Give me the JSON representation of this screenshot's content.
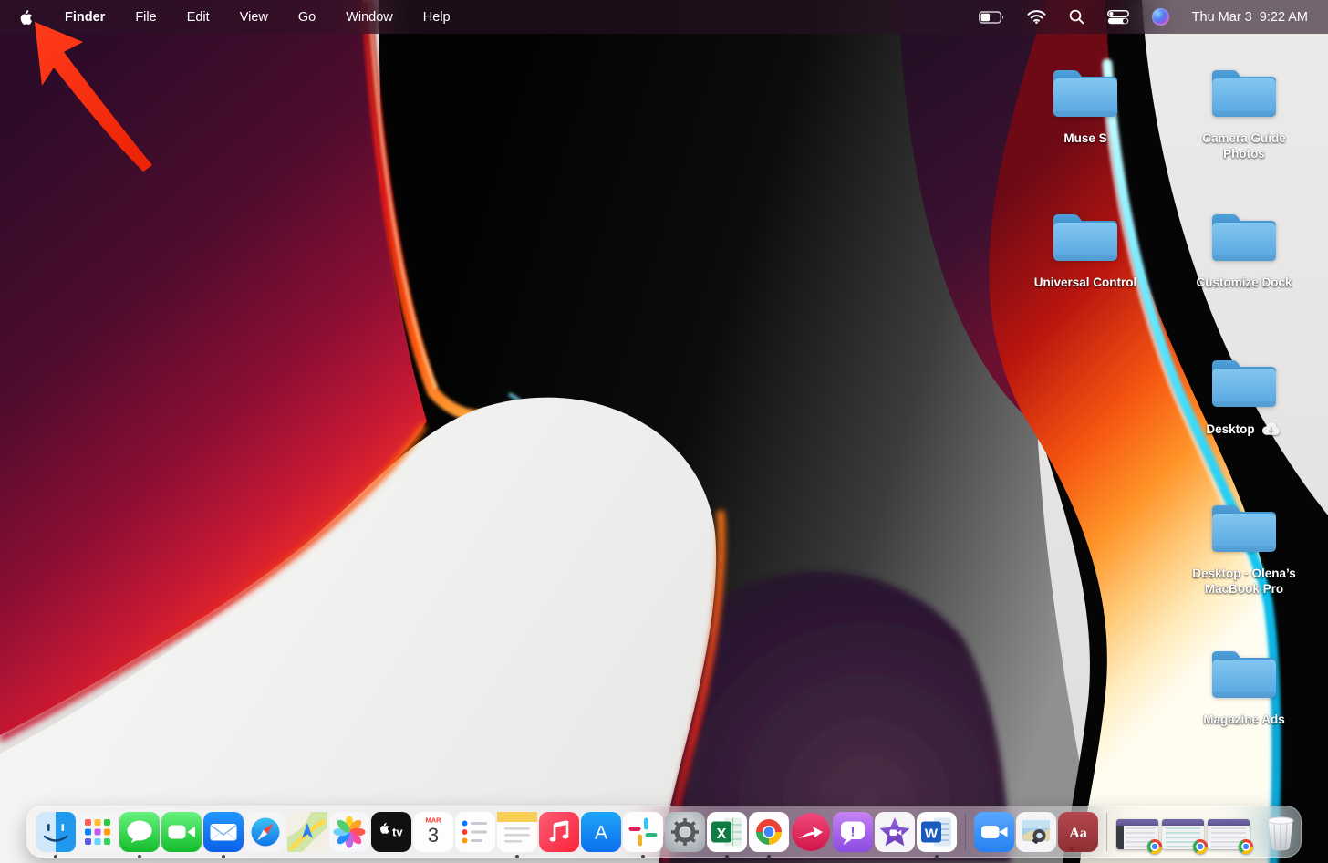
{
  "menu_bar": {
    "apple_logo_icon": "apple-logo",
    "active_app": "Finder",
    "menus": [
      "Finder",
      "File",
      "Edit",
      "View",
      "Go",
      "Window",
      "Help"
    ],
    "status": {
      "battery_percent_visual": 45,
      "icons": [
        "battery-icon",
        "wifi-icon",
        "spotlight-search-icon",
        "control-center-icon",
        "siri-icon"
      ],
      "clock": "Thu Mar 3  9:22 AM"
    }
  },
  "desktop": {
    "wallpaper": "macOS Monterey abstract swirl",
    "annotation_arrow": {
      "color": "#ff2713",
      "points_to": "apple-menu-logo"
    },
    "folders": [
      {
        "label": "Muse S"
      },
      {
        "label": "Camera Guide Photos"
      },
      {
        "label": "Universal Control"
      },
      {
        "label": "Customize Dock"
      },
      {
        "label": "Desktop",
        "badge": "icloud-download-icon"
      },
      {
        "label": "Desktop - Olena’s MacBook Pro"
      },
      {
        "label": "Magazine Ads"
      }
    ]
  },
  "dock": {
    "apps": [
      "finder",
      "launchpad",
      "messages",
      "facetime",
      "mail",
      "safari",
      "maps",
      "photos",
      "apple-tv",
      "calendar",
      "reminders",
      "notes",
      "music",
      "app-store",
      "slack",
      "system-preferences",
      "excel",
      "chrome",
      "skitch",
      "chat-app",
      "imovie",
      "word",
      "zoom",
      "preview",
      "dictionary",
      "minimized-window",
      "minimized-window",
      "minimized-window",
      "trash"
    ],
    "running": [
      "finder",
      "messages",
      "mail",
      "notes",
      "slack",
      "excel",
      "chrome",
      "word"
    ],
    "glyphs": {
      "calendar_month": "MAR",
      "calendar_day": "3",
      "appletv": "tv",
      "appstore": "A",
      "excel": "X",
      "word": "W",
      "dictionary": "Aa",
      "chat": "!"
    }
  },
  "colors": {
    "arrow_red": "#ff2713",
    "folder_blue": "#63b1e8",
    "menu_bar_tint": "#281324",
    "dock_tint": "#f6f2f6",
    "wallpaper_palette": [
      "#2b0b28",
      "#c41834",
      "#ff5a0e",
      "#0f0f0f",
      "#e8e8e6",
      "#45e0ff",
      "#f2f2f0"
    ]
  }
}
